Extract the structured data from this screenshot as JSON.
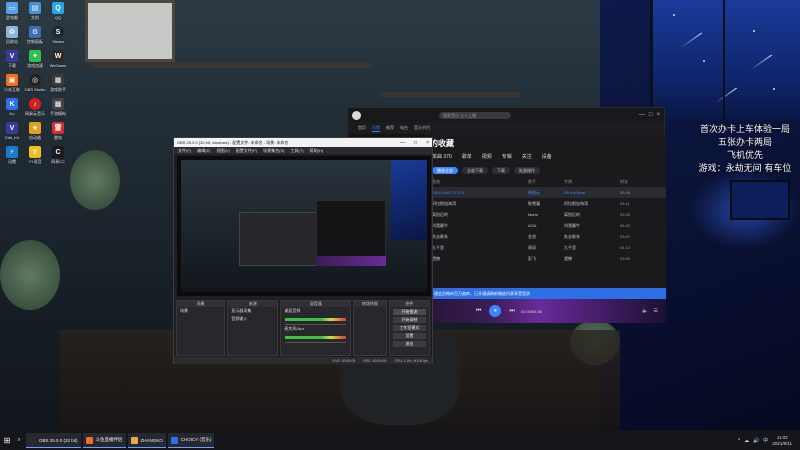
{
  "desktop": {
    "icons_col1": [
      {
        "label": "此电脑",
        "icon": "computer-icon",
        "color": "#5aa0e8"
      },
      {
        "label": "回收站",
        "icon": "recycle-bin-icon",
        "color": "#8fb5d8"
      },
      {
        "label": "下载",
        "icon": "app-icon",
        "color": "#3a3a9a"
      },
      {
        "label": "小米互联",
        "icon": "app-icon",
        "color": "#f07020"
      },
      {
        "label": "Ko",
        "icon": "app-icon",
        "color": "#2d6fe6"
      },
      {
        "label": "Edit_Kit",
        "icon": "app-icon",
        "color": "#3a3a9a"
      },
      {
        "label": "迅雷",
        "icon": "app-icon",
        "color": "#1f78d0"
      }
    ],
    "icons_col2": [
      {
        "label": "文档",
        "icon": "folder-icon",
        "color": "#4a90d9"
      },
      {
        "label": "控制面板",
        "icon": "control-panel-icon",
        "color": "#3a6fb0"
      },
      {
        "label": "游戏加速",
        "icon": "app-icon",
        "color": "#2fbf4f"
      },
      {
        "label": "OBS Studio",
        "icon": "obs-icon",
        "color": "#222222"
      },
      {
        "label": "网易云音乐",
        "icon": "netease-music-icon",
        "color": "#d02020"
      },
      {
        "label": "启动器",
        "icon": "app-icon",
        "color": "#e0a020"
      },
      {
        "label": "YY语音",
        "icon": "app-icon",
        "color": "#f0c020"
      }
    ],
    "icons_col3": [
      {
        "label": "QQ",
        "icon": "qq-icon",
        "color": "#2aa6e6"
      },
      {
        "label": "Steam",
        "icon": "steam-icon",
        "color": "#1b2838"
      },
      {
        "label": "WeGame",
        "icon": "wegame-icon",
        "color": "#2a2a2a"
      },
      {
        "label": "游戏助手",
        "icon": "app-icon",
        "color": "#3a3a3a"
      },
      {
        "label": "手游模拟",
        "icon": "app-icon",
        "color": "#444444"
      },
      {
        "label": "雷电",
        "icon": "app-icon",
        "color": "#d03030"
      },
      {
        "label": "网易CC",
        "icon": "app-icon",
        "color": "#1a1a1a"
      }
    ]
  },
  "overlay_text": [
    "首次办卡上车体验一局",
    "五张办卡两局",
    "飞机优先",
    "游戏：永劫无间 有车位"
  ],
  "music": {
    "search_placeholder": "搜索音乐 让人上瘾",
    "window_controls": [
      "—",
      "□",
      "×"
    ],
    "tabs": [
      "首页",
      "乐馆",
      "推荐",
      "电台",
      "音乐节目"
    ],
    "active_tab": "乐馆",
    "heading": "的收藏",
    "sub_tabs": [
      "单曲 370",
      "歌单",
      "视频",
      "专辑",
      "关注",
      "设备"
    ],
    "actions": [
      "播放全部",
      "全部下载",
      "下载",
      "批量操作"
    ],
    "columns": [
      "歌曲",
      "歌手",
      "专辑",
      "时长"
    ],
    "rows": [
      {
        "title": "SKILLAND CLICK",
        "artist": "杨霞云",
        "album": "Fill the Beat",
        "time": "03:46"
      },
      {
        "title": "阿拉斯加海湾",
        "artist": "陈雪凝",
        "album": "阿拉斯加海湾",
        "time": "04:11"
      },
      {
        "title": "离别后的",
        "artist": "Marin",
        "album": "离别后的",
        "time": "03:25"
      },
      {
        "title": "叫我最牛",
        "artist": "AGA",
        "album": "叫我最牛",
        "time": "04:02"
      },
      {
        "title": "失去联系",
        "artist": "金池",
        "album": "失去联系",
        "time": "03:47"
      },
      {
        "title": "九千里",
        "artist": "周深",
        "album": "九千里",
        "time": "04:13"
      },
      {
        "title": "遗憾",
        "artist": "彭飞",
        "album": "遗憾",
        "time": "03:59"
      }
    ],
    "banner": "开通会员畅听百万曲库，已开通请刷新播放列表享受音质",
    "player_time": "01:00/03:46",
    "player_ctrls": [
      "⏮",
      "⏸",
      "⏭"
    ]
  },
  "obs": {
    "title": "OBS 25.0.0 (32 bit, windows) - 配置文件: 未命名 - 场景: 未命名",
    "menu": [
      "文件(F)",
      "编辑(E)",
      "视图(V)",
      "配置文件(P)",
      "场景集合(S)",
      "工具(T)",
      "帮助(H)"
    ],
    "docks": [
      "场景",
      "来源",
      "混音器",
      "转场特效",
      "控件"
    ],
    "scene_item": "场景",
    "sources": [
      "显示器采集",
      "音频输入"
    ],
    "mixer_channels": [
      "桌面音频",
      "麦克风/Aux"
    ],
    "controls": [
      "开始推流",
      "开始录制",
      "工作室模式",
      "设置",
      "退出"
    ],
    "status": [
      "LIVE: 00:00:00",
      "REC: 00:00:00",
      "CPU: 1.9%, 60.00 fps"
    ]
  },
  "taskbar": {
    "apps": [
      {
        "label": "OBS 25.0.0 (32 bit)",
        "icon": "obs-icon",
        "color": "#2a2a2a"
      },
      {
        "label": "斗鱼直播伴侣",
        "icon": "app-icon",
        "color": "#f07020"
      },
      {
        "label": "ZHANGKO",
        "icon": "folder-icon",
        "color": "#e0b040"
      },
      {
        "label": "CHOICY (音乐)",
        "icon": "app-icon",
        "color": "#2d6fe6"
      }
    ],
    "tray_icons": [
      "^",
      "☁",
      "🔊",
      "中"
    ],
    "time": "11:02",
    "date": "2021/9/11"
  }
}
